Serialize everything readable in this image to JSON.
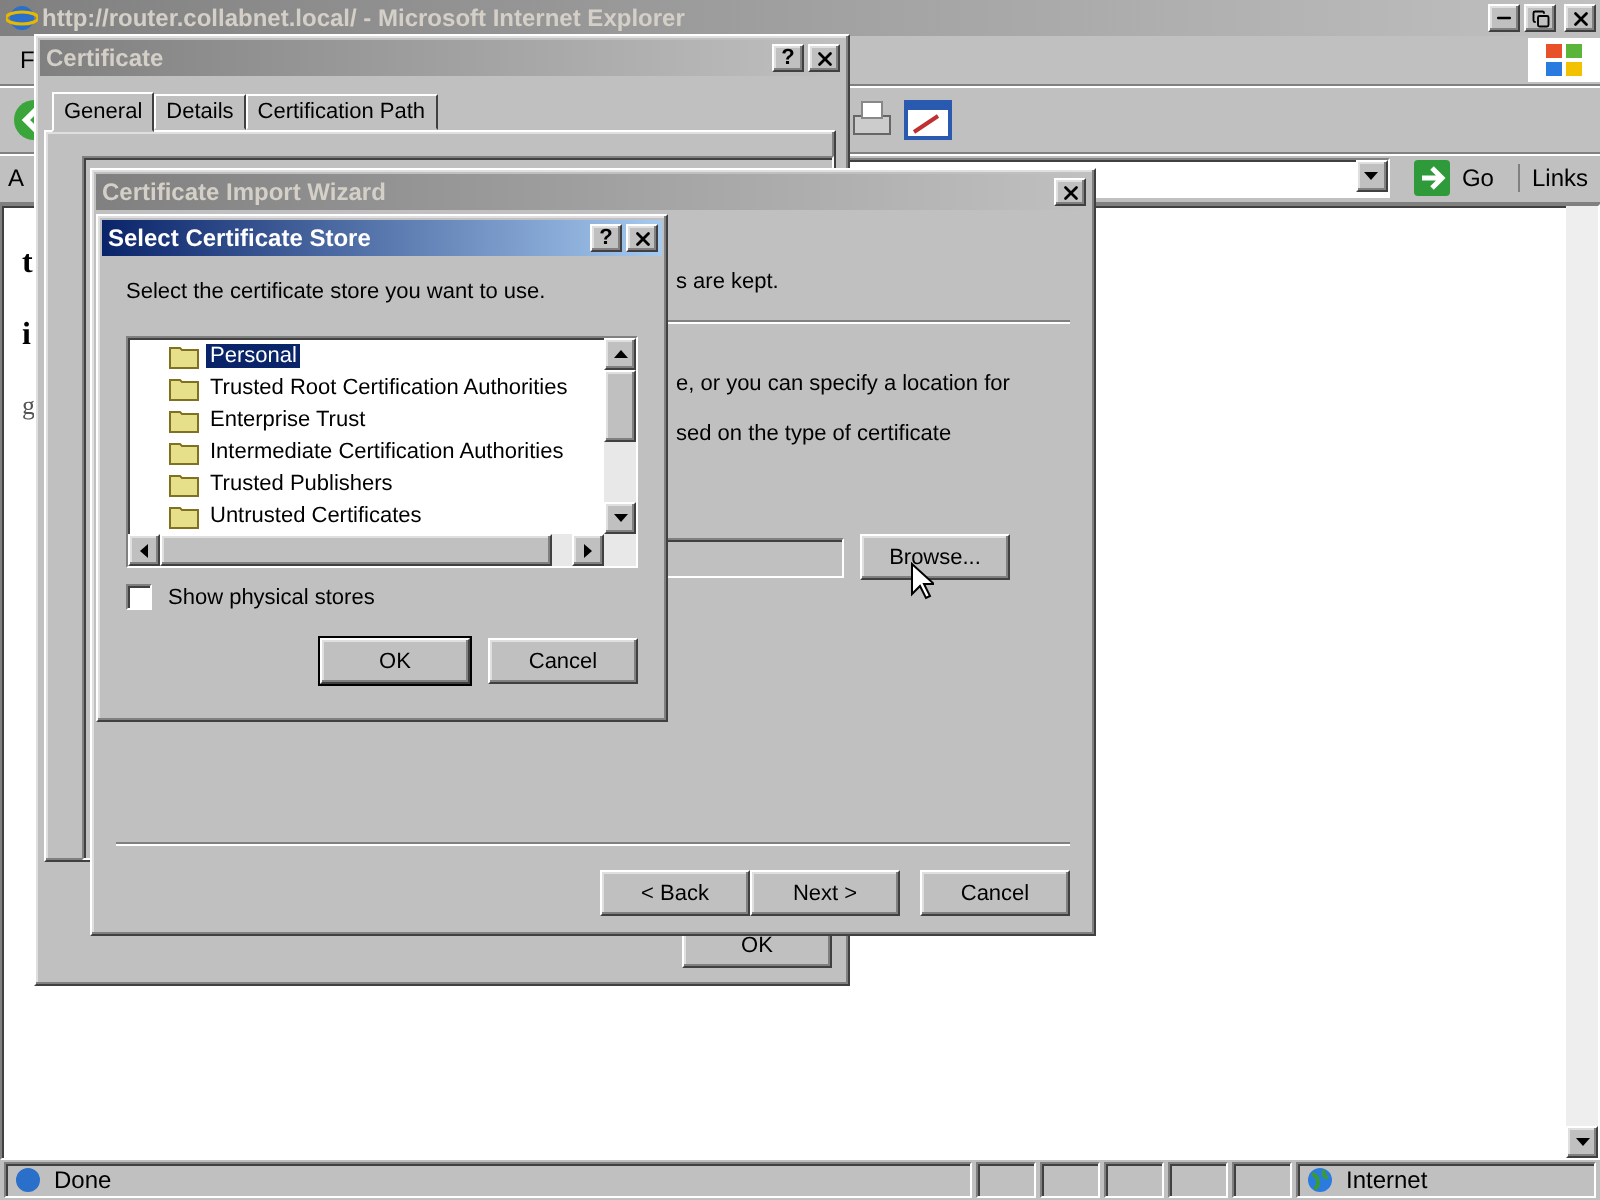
{
  "browser": {
    "title": "http://router.collabnet.local/ - Microsoft Internet Explorer",
    "menu_fragment": "F",
    "address_label": "A",
    "go_button": "Go",
    "links": "Links",
    "page_fragments": [
      {
        "text": "t",
        "kind": "bold"
      },
      {
        "text": "i",
        "kind": "bold"
      },
      {
        "text": "g",
        "kind": "link"
      }
    ],
    "status_text": "Done",
    "zone": "Internet"
  },
  "certificate_dialog": {
    "title": "Certificate",
    "help": "?",
    "tabs": [
      {
        "label": "General",
        "selected": true
      },
      {
        "label": "Details",
        "selected": false
      },
      {
        "label": "Certification Path",
        "selected": false
      }
    ],
    "ok_button": "OK"
  },
  "import_wizard": {
    "title": "Certificate Import Wizard",
    "text_lines": [
      "s are kept.",
      "e, or you can specify a location for",
      "sed on the type of certificate"
    ],
    "browse_button": "Browse...",
    "buttons": [
      "< Back",
      "Next >",
      "Cancel"
    ]
  },
  "store_dialog": {
    "title": "Select Certificate Store",
    "help": "?",
    "prompt": "Select the certificate store you want to use.",
    "stores": [
      {
        "label": "Personal",
        "selected": true
      },
      {
        "label": "Trusted Root Certification Authorities",
        "selected": false
      },
      {
        "label": "Enterprise Trust",
        "selected": false
      },
      {
        "label": "Intermediate Certification Authorities",
        "selected": false
      },
      {
        "label": "Trusted Publishers",
        "selected": false
      },
      {
        "label": "Untrusted Certificates",
        "selected": false
      }
    ],
    "show_physical_stores": {
      "label": "Show physical stores",
      "checked": false
    },
    "buttons": [
      "OK",
      "Cancel"
    ]
  }
}
